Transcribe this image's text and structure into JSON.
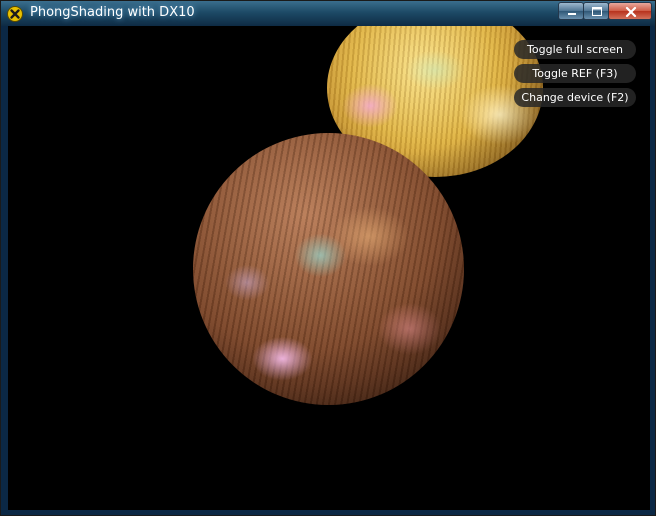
{
  "window": {
    "title": "PhongShading with DX10"
  },
  "hud": {
    "toggle_fullscreen": "Toggle full screen",
    "toggle_ref": "Toggle REF (F3)",
    "change_device": "Change device (F2)"
  },
  "scene": {
    "objects": [
      "gold-sphere",
      "bronze-sphere"
    ],
    "background": "#000000"
  }
}
